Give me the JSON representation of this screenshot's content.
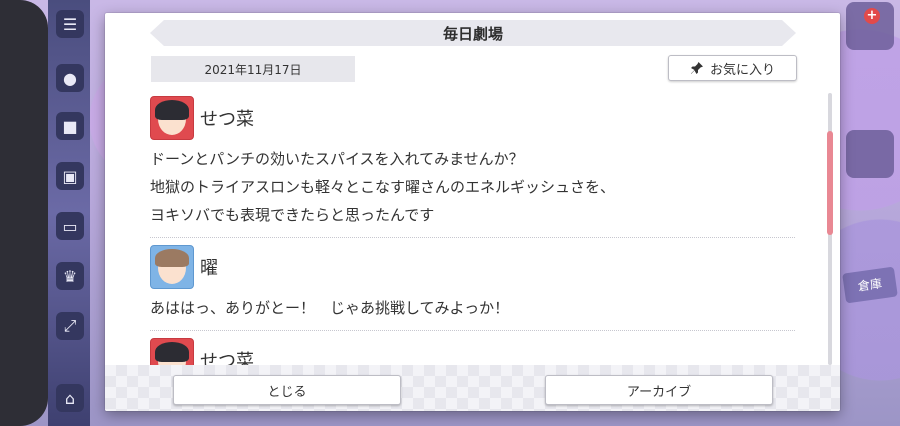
{
  "dialog": {
    "title": "毎日劇場",
    "date": "2021年11月17日",
    "favorite_label": "お気に入り"
  },
  "entries": [
    {
      "speaker": "せつ菜",
      "avatar_color": "#e04a4f",
      "lines": [
        "ドーンとパンチの効いたスパイスを入れてみませんか？",
        "地獄のトライアスロンも軽々とこなす曜さんのエネルギッシュさを、",
        "ヨキソバでも表現できたらと思ったんです"
      ]
    },
    {
      "speaker": "曜",
      "avatar_color": "#7fb4e6",
      "lines": [
        "あははっ、ありがとー！　じゃあ挑戦してみよっか！"
      ]
    },
    {
      "speaker": "せつ菜",
      "avatar_color": "#e04a4f",
      "lines": []
    }
  ],
  "footer": {
    "close_label": "とじる",
    "archive_label": "アーカイブ"
  },
  "background": {
    "side_tag": "倉庫",
    "badge": "+"
  },
  "colors": {
    "accent_scroll": "#e98893",
    "panel": "#ffffff",
    "title_bg": "#e8e8ee"
  }
}
